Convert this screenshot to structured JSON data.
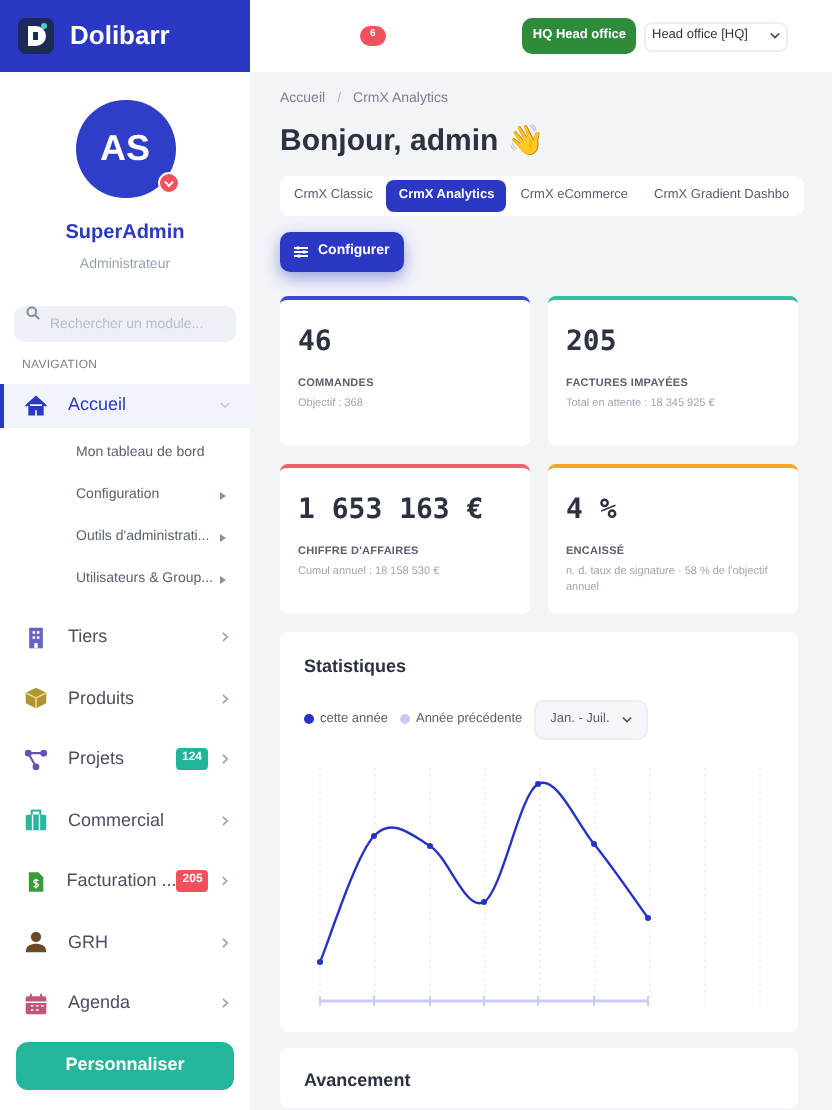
{
  "brand": {
    "name": "Dolibarr"
  },
  "topbar": {
    "notification_count": "6",
    "entity_badge": "HQ Head office",
    "entity_select": "Head office [HQ]"
  },
  "user": {
    "initials": "AS",
    "name": "SuperAdmin",
    "role": "Administrateur"
  },
  "search": {
    "placeholder": "Rechercher un module..."
  },
  "nav_heading": "NAVIGATION",
  "nav": [
    {
      "label": "Accueil",
      "selected": true,
      "expanded": true,
      "children": [
        {
          "label": "Mon tableau de bord",
          "has_submenu": false
        },
        {
          "label": "Configuration",
          "has_submenu": true
        },
        {
          "label": "Outils d'administrati...",
          "has_submenu": true
        },
        {
          "label": "Utilisateurs & Group...",
          "has_submenu": true
        }
      ]
    },
    {
      "label": "Tiers",
      "selected": false,
      "expanded": false
    },
    {
      "label": "Produits",
      "selected": false,
      "expanded": false
    },
    {
      "label": "Projets",
      "selected": false,
      "expanded": false,
      "badge": {
        "text": "124",
        "color": "#23b59c"
      }
    },
    {
      "label": "Commercial",
      "selected": false,
      "expanded": false
    },
    {
      "label": "Facturation ...",
      "selected": false,
      "expanded": false,
      "badge": {
        "text": "205",
        "color": "#f0515c"
      }
    },
    {
      "label": "GRH",
      "selected": false,
      "expanded": false
    },
    {
      "label": "Agenda",
      "selected": false,
      "expanded": false
    }
  ],
  "customize_button": "Personnaliser",
  "breadcrumb": {
    "separator": "/",
    "items": [
      "Accueil",
      "CrmX Analytics"
    ]
  },
  "greeting": "Bonjour, admin 👋",
  "tabs": [
    {
      "label": "CrmX Classic",
      "selected": false
    },
    {
      "label": "CrmX Analytics",
      "selected": true
    },
    {
      "label": "CrmX eCommerce",
      "selected": false
    },
    {
      "label": "CrmX Gradient Dashbo",
      "selected": false
    }
  ],
  "configure_button": "Configurer",
  "kpis": [
    {
      "value": "46",
      "title": "COMMANDES",
      "note": "Objectif : 368",
      "color": "#3b4bd0"
    },
    {
      "value": "205",
      "title": "FACTURES IMPAYÉES",
      "note": "Total en attente : 18 345 925 €",
      "color": "#2fc0a6"
    },
    {
      "value": "1 653 163 €",
      "title": "CHIFFRE D'AFFAIRES",
      "note": "Cumul annuel : 18 158 530 €",
      "color": "#f0626a"
    },
    {
      "value": "4 %",
      "title": "ENCAISSÉ",
      "note": "n. d. taux de signature · 58 % de l'objectif annuel",
      "color": "#f5a623"
    }
  ],
  "stats": {
    "title": "Statistiques",
    "legend": [
      {
        "label": "cette année",
        "color": "#2633c2"
      },
      {
        "label": "Année précédente",
        "color": "#c9ccf2"
      }
    ],
    "period": "Jan. - Juil."
  },
  "progress": {
    "title": "Avancement"
  }
}
